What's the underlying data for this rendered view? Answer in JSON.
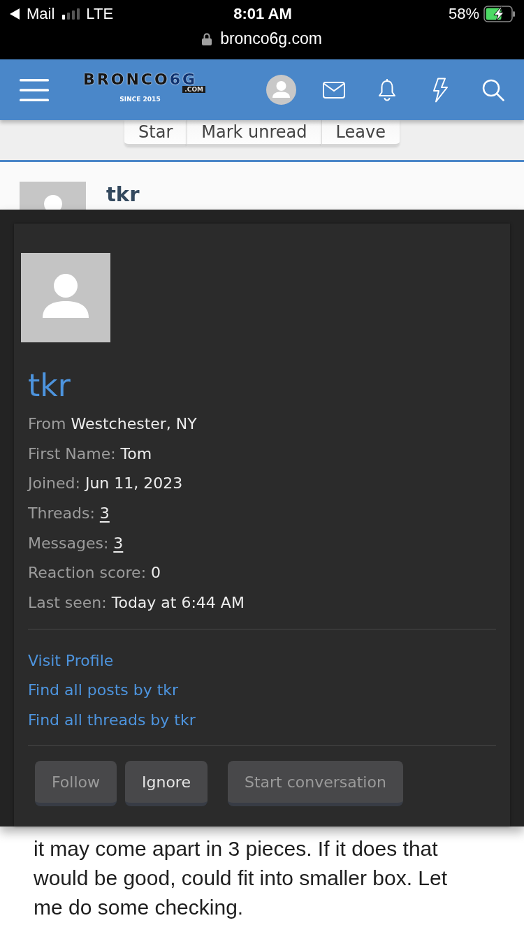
{
  "status_bar": {
    "back_app": "Mail",
    "network": "LTE",
    "time": "8:01 AM",
    "battery": "58%",
    "url": "bronco6g.com"
  },
  "header": {
    "logo": {
      "wordmark": "BRONCO",
      "accent": "6G",
      "domain": ".COM",
      "tagline": "SINCE 2015"
    }
  },
  "thread_actions": [
    {
      "label": "Star"
    },
    {
      "label": "Mark unread"
    },
    {
      "label": "Leave"
    }
  ],
  "member_row": {
    "name": "tkr"
  },
  "member_card": {
    "name": "tkr",
    "details": [
      {
        "label": "From",
        "value": "Westchester, NY",
        "kind": "text"
      },
      {
        "label": "First Name:",
        "value": "Tom",
        "kind": "text"
      },
      {
        "label": "Joined:",
        "value": "Jun 11, 2023",
        "kind": "text"
      },
      {
        "label": "Threads:",
        "value": "3",
        "kind": "link"
      },
      {
        "label": "Messages:",
        "value": "3",
        "kind": "link"
      },
      {
        "label": "Reaction score:",
        "value": "0",
        "kind": "text"
      },
      {
        "label": "Last seen:",
        "value": "Today at 6:44 AM",
        "kind": "text"
      }
    ],
    "links": [
      "Visit Profile",
      "Find all posts by tkr",
      "Find all threads by tkr"
    ],
    "buttons": [
      {
        "label": "Follow",
        "disabled": true
      },
      {
        "label": "Ignore",
        "disabled": false
      },
      {
        "label": "Start conversation",
        "disabled": true
      }
    ]
  },
  "post": {
    "text": "it may come apart in 3 pieces. If it does that would be good, could fit into smaller box. Let me do some checking."
  }
}
